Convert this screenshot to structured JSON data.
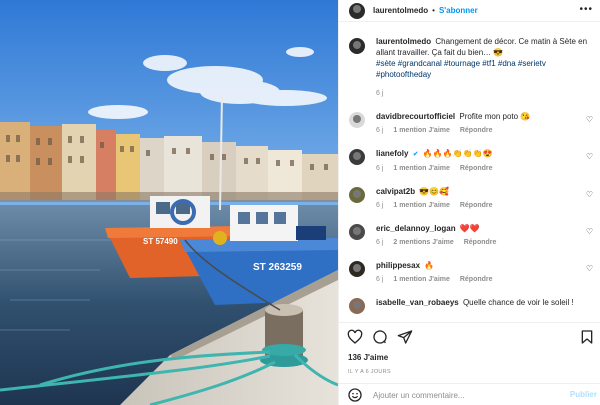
{
  "post": {
    "username": "laurentolmedo",
    "follow_label": "S'abonner",
    "more_label": "•••",
    "caption_text": "Changement de décor. Ce matin à Sète en allant travailler. Ça fait du bien… 😎",
    "hashtags": "#sète #grandcanal #tournage #tf1 #dna #serietv #photooftheday",
    "caption_age": "6 j"
  },
  "comments": [
    {
      "username": "davidbrecourtofficiel",
      "text": "Profite mon poto 😘",
      "age": "6 j",
      "likes": "1 mention J'aime",
      "reply": "Répondre",
      "avatar_color": "#d9d9d9"
    },
    {
      "username": "lianefoly",
      "verified": true,
      "text": "🔥🔥🔥👏👏👏😍",
      "age": "6 j",
      "likes": "1 mention J'aime",
      "reply": "Répondre",
      "avatar_color": "#3a3a3a"
    },
    {
      "username": "calvipat2b",
      "text": "😎😊🥰",
      "age": "6 j",
      "likes": "1 mention J'aime",
      "reply": "Répondre",
      "avatar_color": "#6b6a3a"
    },
    {
      "username": "eric_delannoy_logan",
      "text": "❤️❤️",
      "age": "6 j",
      "likes": "2 mentions J'aime",
      "reply": "Répondre",
      "avatar_color": "#4a4a4a"
    },
    {
      "username": "philippesax",
      "text": "🔥",
      "age": "6 j",
      "likes": "1 mention J'aime",
      "reply": "Répondre",
      "avatar_color": "#2e2a22"
    },
    {
      "username": "isabelle_van_robaeys",
      "text": "Quelle chance de voir le soleil !",
      "age": "",
      "likes": "",
      "reply": "",
      "avatar_color": "#8a6a55"
    }
  ],
  "actions": {
    "likes": "136 J'aime",
    "date": "IL Y A 6 JOURS",
    "comment_placeholder": "Ajouter un commentaire...",
    "publish_label": "Publier"
  },
  "photo": {
    "boat_name_orange": "ST 57490",
    "boat_name_blue": "ST 263259"
  },
  "colors": {
    "link_blue": "#0095f6",
    "hashtag_blue": "#00376b",
    "meta_gray": "#8e8e8e",
    "sky": "#3f86db",
    "boat_orange": "#e2632a",
    "boat_blue": "#2f6fc4"
  }
}
